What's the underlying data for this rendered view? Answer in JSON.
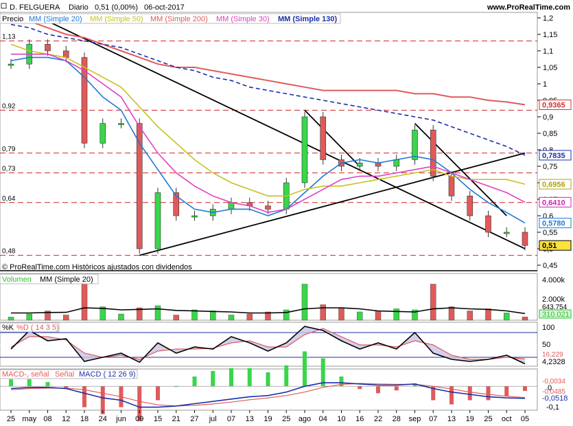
{
  "header": {
    "title": "D. FELGUERA",
    "period": "Diario",
    "quote": "0,51 (0,00%)",
    "date": "06-oct-2017",
    "site": "www.ProRealTime.com"
  },
  "price_panel": {
    "label": "Precio",
    "legend": [
      {
        "text": "MM (Simple 20)",
        "color": "#1f77d4"
      },
      {
        "text": "MM (Simple 50)",
        "color": "#c8c020"
      },
      {
        "text": "MM (Simple 200)",
        "color": "#e05a5a"
      },
      {
        "text": "MM (Simple 30)",
        "color": "#e040c0"
      },
      {
        "text": "MM (Simple 130)",
        "color": "#1a2ea8"
      }
    ],
    "footer": "© ProRealTime.com  Históricos ajustados con dividendos",
    "y_ticks": [
      "1,2",
      "1,15",
      "1,1",
      "1,05",
      "1",
      "0,95",
      "0,9",
      "0,85",
      "0,8",
      "0,75",
      "0,7",
      "0,65",
      "0,6",
      "0,55",
      "0,5",
      "0,45"
    ],
    "support_levels": [
      "1,13",
      "0,92",
      "0,79",
      "0,73",
      "0,64",
      "0,48"
    ],
    "last_value_labels": [
      {
        "text": "0,9365",
        "color": "#d03030",
        "value": 0.9365
      },
      {
        "text": "0,7835",
        "color": "#1a2ea8",
        "value": 0.7835
      },
      {
        "text": "0,6956",
        "color": "#b0a010",
        "value": 0.6956
      },
      {
        "text": "0,6410",
        "color": "#d020b0",
        "value": 0.641
      },
      {
        "text": "0,5780",
        "color": "#1f77d4",
        "value": 0.578
      },
      {
        "text": "0,51",
        "color": "#000000",
        "value": 0.51
      }
    ]
  },
  "volume_panel": {
    "label": "Volumen",
    "legend": "MM (Simple 20)",
    "y_ticks": [
      "4.000k",
      "2.000k"
    ],
    "value_labels": [
      "643.754",
      "310.021"
    ]
  },
  "stoch_panel": {
    "label": "%K",
    "legend": "%D ( 14 3 5)",
    "y_ticks": [
      "100",
      "50"
    ],
    "value_labels": [
      "16,229",
      "4,2328"
    ]
  },
  "macd_panel": {
    "label": "MACD-, señal",
    "legend1": "Señal",
    "legend2": "MACD ( 12 26 9)",
    "y_ticks": [
      "0",
      "-0,1"
    ],
    "value_labels": [
      "-0,0034",
      "-0,0485",
      "-0,0518"
    ]
  },
  "x_axis": {
    "labels": [
      "25",
      "may",
      "08",
      "12",
      "18",
      "24",
      "jun",
      "09",
      "15",
      "21",
      "27",
      "jul",
      "07",
      "13",
      "19",
      "25",
      "ago",
      "04",
      "10",
      "16",
      "22",
      "28",
      "sep",
      "07",
      "13",
      "19",
      "25",
      "oct",
      "05"
    ]
  },
  "chart_data": [
    {
      "type": "line",
      "name": "Precio",
      "y_range": [
        0.45,
        1.2
      ],
      "x": [
        "25",
        "may",
        "08",
        "12",
        "18",
        "24",
        "jun",
        "09",
        "15",
        "21",
        "27",
        "jul",
        "07",
        "13",
        "19",
        "25",
        "ago",
        "04",
        "10",
        "16",
        "22",
        "28",
        "sep",
        "07",
        "13",
        "19",
        "25",
        "oct",
        "05"
      ],
      "close": [
        1.06,
        1.12,
        1.1,
        1.08,
        0.82,
        0.88,
        0.88,
        0.5,
        0.67,
        0.6,
        0.6,
        0.62,
        0.64,
        0.63,
        0.62,
        0.7,
        0.9,
        0.77,
        0.75,
        0.76,
        0.75,
        0.77,
        0.86,
        0.72,
        0.66,
        0.6,
        0.55,
        0.55,
        0.51
      ],
      "series": [
        {
          "name": "MM (Simple 20)",
          "values": [
            1.07,
            1.08,
            1.08,
            1.07,
            1.02,
            0.96,
            0.92,
            0.82,
            0.74,
            0.66,
            0.62,
            0.61,
            0.62,
            0.62,
            0.6,
            0.62,
            0.67,
            0.72,
            0.76,
            0.77,
            0.76,
            0.77,
            0.78,
            0.77,
            0.73,
            0.68,
            0.64,
            0.61,
            0.578
          ]
        },
        {
          "name": "MM (Simple 50)",
          "values": [
            1.12,
            1.1,
            1.09,
            1.08,
            1.05,
            1.02,
            0.99,
            0.93,
            0.87,
            0.82,
            0.77,
            0.73,
            0.7,
            0.68,
            0.66,
            0.66,
            0.68,
            0.69,
            0.69,
            0.7,
            0.71,
            0.72,
            0.73,
            0.74,
            0.72,
            0.71,
            0.71,
            0.71,
            0.6956
          ]
        },
        {
          "name": "MM (Simple 200)",
          "values": [
            1.2,
            1.19,
            1.17,
            1.15,
            1.14,
            1.12,
            1.1,
            1.08,
            1.06,
            1.05,
            1.05,
            1.04,
            1.03,
            1.02,
            1.01,
            1.0,
            0.99,
            0.98,
            0.98,
            0.98,
            0.98,
            0.98,
            0.97,
            0.97,
            0.96,
            0.96,
            0.95,
            0.945,
            0.9365
          ]
        },
        {
          "name": "MM (Simple 30)",
          "values": [
            1.09,
            1.09,
            1.09,
            1.07,
            1.04,
            1.0,
            0.96,
            0.87,
            0.79,
            0.73,
            0.69,
            0.66,
            0.64,
            0.63,
            0.61,
            0.62,
            0.65,
            0.68,
            0.71,
            0.72,
            0.72,
            0.73,
            0.74,
            0.75,
            0.73,
            0.71,
            0.69,
            0.67,
            0.641
          ]
        },
        {
          "name": "MM (Simple 130)",
          "values": [
            1.18,
            1.17,
            1.15,
            1.14,
            1.13,
            1.12,
            1.11,
            1.09,
            1.07,
            1.05,
            1.04,
            1.02,
            1.01,
            0.99,
            0.98,
            0.97,
            0.96,
            0.95,
            0.94,
            0.93,
            0.92,
            0.91,
            0.9,
            0.89,
            0.87,
            0.85,
            0.83,
            0.81,
            0.7835
          ]
        }
      ]
    },
    {
      "type": "bar",
      "name": "Volumen",
      "y_range": [
        0,
        4000
      ],
      "x": [
        "25",
        "may",
        "08",
        "12",
        "18",
        "24",
        "jun",
        "09",
        "15",
        "21",
        "27",
        "jul",
        "07",
        "13",
        "19",
        "25",
        "ago",
        "04",
        "10",
        "16",
        "22",
        "28",
        "sep",
        "07",
        "13",
        "19",
        "25",
        "oct",
        "05"
      ],
      "values": [
        300,
        600,
        900,
        500,
        3600,
        1300,
        600,
        1200,
        1400,
        500,
        1000,
        900,
        500,
        600,
        800,
        1000,
        3500,
        1500,
        1200,
        800,
        900,
        1100,
        1000,
        3500,
        1300,
        900,
        1100,
        700,
        310
      ],
      "series": [
        {
          "name": "MM (Simple 20)",
          "values": [
            700,
            700,
            750,
            760,
            1200,
            1150,
            1000,
            1050,
            1100,
            950,
            900,
            850,
            800,
            700,
            700,
            750,
            1100,
            1200,
            1200,
            1100,
            900,
            850,
            800,
            1100,
            1200,
            1100,
            1050,
            900,
            643.754
          ]
        }
      ]
    },
    {
      "type": "line",
      "name": "%K",
      "y_range": [
        0,
        100
      ],
      "x": [
        "25",
        "may",
        "08",
        "12",
        "18",
        "24",
        "jun",
        "09",
        "15",
        "21",
        "27",
        "jul",
        "07",
        "13",
        "19",
        "25",
        "ago",
        "04",
        "10",
        "16",
        "22",
        "28",
        "sep",
        "07",
        "13",
        "19",
        "25",
        "oct",
        "05"
      ],
      "series": [
        {
          "name": "%K",
          "values": [
            40,
            85,
            60,
            65,
            10,
            20,
            30,
            8,
            55,
            30,
            45,
            40,
            70,
            55,
            35,
            55,
            95,
            85,
            60,
            40,
            55,
            40,
            80,
            30,
            15,
            10,
            15,
            25,
            4.2328
          ]
        },
        {
          "name": "%D ( 14 3 5)",
          "values": [
            45,
            70,
            70,
            62,
            30,
            20,
            25,
            15,
            35,
            40,
            40,
            42,
            55,
            60,
            45,
            45,
            75,
            90,
            70,
            50,
            50,
            45,
            60,
            50,
            25,
            15,
            15,
            20,
            16.229
          ]
        }
      ]
    },
    {
      "type": "line",
      "name": "MACD ( 12 26 9)",
      "y_range": [
        -0.1,
        0.03
      ],
      "x": [
        "25",
        "may",
        "08",
        "12",
        "18",
        "24",
        "jun",
        "09",
        "15",
        "21",
        "27",
        "jul",
        "07",
        "13",
        "19",
        "25",
        "ago",
        "04",
        "10",
        "16",
        "22",
        "28",
        "sep",
        "07",
        "13",
        "19",
        "25",
        "oct",
        "05"
      ],
      "series": [
        {
          "name": "MACD ( 12 26 9)",
          "values": [
            -0.01,
            -0.005,
            -0.005,
            -0.01,
            -0.03,
            -0.05,
            -0.06,
            -0.09,
            -0.09,
            -0.085,
            -0.075,
            -0.065,
            -0.055,
            -0.045,
            -0.04,
            -0.025,
            0.0,
            0.015,
            0.015,
            0.01,
            0.005,
            0.005,
            0.01,
            -0.01,
            -0.025,
            -0.035,
            -0.045,
            -0.05,
            -0.0518
          ]
        },
        {
          "name": "Señal",
          "values": [
            -0.015,
            -0.01,
            -0.008,
            -0.008,
            -0.015,
            -0.03,
            -0.045,
            -0.065,
            -0.08,
            -0.085,
            -0.082,
            -0.076,
            -0.068,
            -0.058,
            -0.05,
            -0.04,
            -0.025,
            -0.005,
            0.008,
            0.012,
            0.01,
            0.008,
            0.008,
            0.0,
            -0.012,
            -0.025,
            -0.035,
            -0.043,
            -0.0485
          ]
        }
      ]
    }
  ]
}
